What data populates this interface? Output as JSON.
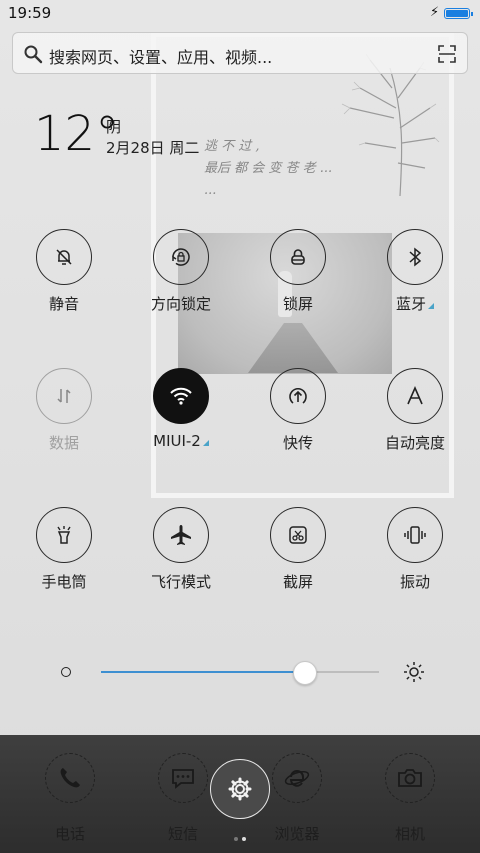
{
  "status_bar": {
    "time": "19:59",
    "charging": "⚡"
  },
  "search": {
    "placeholder": "搜索网页、设置、应用、视频..."
  },
  "weather": {
    "temperature": "12°",
    "condition": "阴",
    "date": "2月28日 周二"
  },
  "wallpaper_poem": {
    "line1": "逃 不 过 ,",
    "line2": "最后 都 会 变 苍 老 ...",
    "line3": "..."
  },
  "toggles": [
    {
      "label": "静音",
      "icon": "mute-bell-icon"
    },
    {
      "label": "方向锁定",
      "icon": "rotation-lock-icon"
    },
    {
      "label": "锁屏",
      "icon": "lock-icon"
    },
    {
      "label": "蓝牙",
      "icon": "bluetooth-icon"
    },
    {
      "label": "数据",
      "icon": "mobile-data-icon"
    },
    {
      "label": "MIUI-2",
      "icon": "wifi-icon",
      "active": true
    },
    {
      "label": "快传",
      "icon": "quick-transfer-icon"
    },
    {
      "label": "自动亮度",
      "icon": "auto-brightness-icon"
    },
    {
      "label": "手电筒",
      "icon": "flashlight-icon"
    },
    {
      "label": "飞行模式",
      "icon": "airplane-icon"
    },
    {
      "label": "截屏",
      "icon": "screenshot-icon"
    },
    {
      "label": "振动",
      "icon": "vibrate-icon"
    }
  ],
  "brightness": {
    "level": 0.73
  },
  "dock": {
    "apps": [
      "电话",
      "短信",
      "浏览器",
      "相机"
    ]
  },
  "colors": {
    "accent": "#3d8fd1",
    "battery": "#1a7fe0",
    "active_toggle": "#111111"
  }
}
